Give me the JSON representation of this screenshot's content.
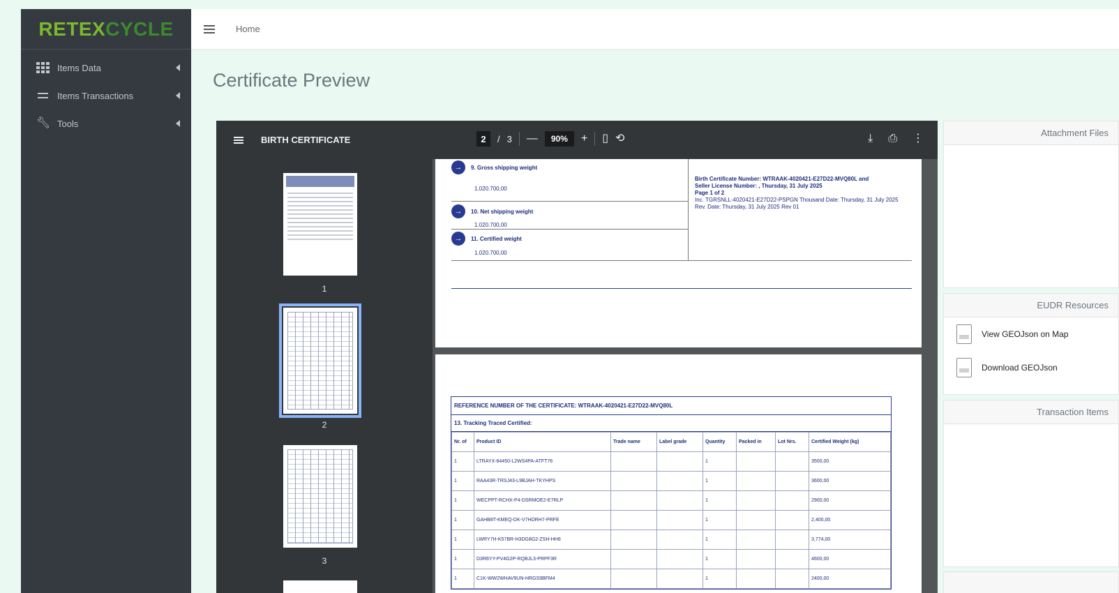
{
  "brand": {
    "part1": "RETEX",
    "part2": "CYCLE"
  },
  "sidebar": {
    "items": [
      {
        "label": "Items Data",
        "icon": "grid-icon"
      },
      {
        "label": "Items Transactions",
        "icon": "exchange-icon"
      },
      {
        "label": "Tools",
        "icon": "wrench-icon"
      }
    ]
  },
  "topbar": {
    "breadcrumb": "Home"
  },
  "page": {
    "title": "Certificate Preview"
  },
  "viewer": {
    "doc_title": "BIRTH CERTIFICATE",
    "page_current": "2",
    "page_sep": "/",
    "page_total": "3",
    "zoom": "90%",
    "minus": "—",
    "plus": "+",
    "thumbnails": [
      "1",
      "2",
      "3"
    ],
    "selected_page": 2,
    "page1": {
      "fields": [
        {
          "num": "→",
          "label": "9. Gross shipping weight",
          "value": "1.020.700,00"
        },
        {
          "num": "→",
          "label": "10. Net shipping weight",
          "value": "1.020.700,00"
        },
        {
          "num": "→",
          "label": "11. Certified weight",
          "value": "1.020.700,00"
        }
      ],
      "cert_info": {
        "line1": "Birth Certificate Number: WTRAAK-4020421-E27D22-MVQ80L and",
        "line2": "Seller License Number: , Thursday, 31 July 2025",
        "line3": "Page 1 of 2",
        "line4": "Inc. TGRSNLL-4020421-E27D22-PSPGN Thousand Date: Thursday, 31 July 2025",
        "line5": "Rev. Date: Thursday, 31 July 2025 Rev 01"
      }
    },
    "page2": {
      "reference": "REFERENCE NUMBER OF THE CERTIFICATE: WTRAAK-4020421-E27D22-MVQ80L",
      "section": "13. Tracking Traced Certified:",
      "columns": [
        "Nr. of",
        "Product ID",
        "Trade name",
        "Label grade",
        "Quantity",
        "Packed in",
        "Lot Nrs.",
        "Certified Weight (kg)"
      ],
      "rows": [
        [
          "1",
          "LTRAYX-84450-L2WS4PA-ATFT76",
          "",
          "",
          "1",
          "",
          "",
          "3500,00"
        ],
        [
          "1",
          "RAA43R-TRSJ43-L9BJAH-TKYHPS",
          "",
          "",
          "1",
          "",
          "",
          "3600,00"
        ],
        [
          "1",
          "WECPPT-RCHX-P4-DSRMOE2-E7RLP",
          "",
          "",
          "1",
          "",
          "",
          "2900,00"
        ],
        [
          "1",
          "GAHB8T-KMEQ-DK-V7HDRH7-PRFE",
          "",
          "",
          "1",
          "",
          "",
          "2,400,00"
        ],
        [
          "1",
          "LWRY7H-K57BR-H3DG8G2-ZSH-HH8",
          "",
          "",
          "1",
          "",
          "",
          "3,774,00"
        ],
        [
          "1",
          "D3R6YY-PV4G2P-RQBJL3-PRPF3R",
          "",
          "",
          "1",
          "",
          "",
          "4600,00"
        ],
        [
          "1",
          "C1K-WW2WHAV9UN-HRGS9BFM4",
          "",
          "",
          "1",
          "",
          "",
          "2400,00"
        ]
      ]
    }
  },
  "right_panel": {
    "attachment_title": "Attachment Files",
    "eudr_title": "EUDR Resources",
    "eudr_items": [
      {
        "label": "View GEOJson on Map",
        "icon": "file-icon"
      },
      {
        "label": "Download GEOJson",
        "icon": "file-icon"
      }
    ],
    "transaction_title": "Transaction Items"
  },
  "colors": {
    "sidebar": "#343a40",
    "brand_green": "#7cb82f",
    "viewer_toolbar": "#323639",
    "accent_blue": "#2a3b8f"
  }
}
